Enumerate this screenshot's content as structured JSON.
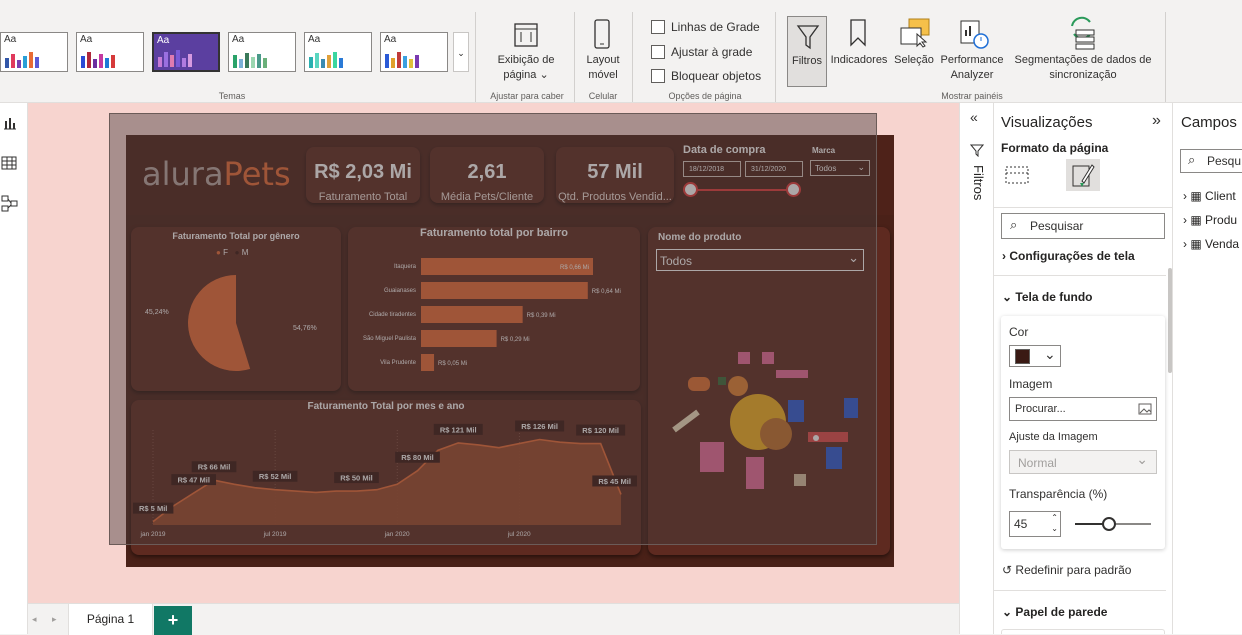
{
  "ribbon": {
    "groups": {
      "themes": "Temas",
      "fit": "Ajustar para caber",
      "mobile": "Celular",
      "page_options": "Opções de página",
      "show_panes": "Mostrar painéis"
    },
    "page_view": {
      "line1": "Exibição de",
      "line2": "página"
    },
    "mobile_layout": {
      "line1": "Layout",
      "line2": "móvel"
    },
    "checkboxes": [
      "Linhas de Grade",
      "Ajustar à grade",
      "Bloquear objetos"
    ],
    "panes": {
      "filters": "Filtros",
      "bookmarks": "Indicadores",
      "selection": "Seleção",
      "performance": {
        "line1": "Performance",
        "line2": "Analyzer"
      },
      "sync": {
        "line1": "Segmentações de dados de",
        "line2": "sincronização"
      }
    },
    "theme_label": "Aa"
  },
  "report": {
    "logo": {
      "part1": "alura",
      "part2": "Pets"
    },
    "kpis": [
      {
        "value": "R$ 2,03 Mi",
        "label": "Faturamento Total"
      },
      {
        "value": "2,61",
        "label": "Média Pets/Cliente"
      },
      {
        "value": "57 Mil",
        "label": "Qtd. Produtos Vendid..."
      }
    ],
    "date_slicer": {
      "title": "Data de compra",
      "from": "18/12/2018",
      "to": "31/12/2020"
    },
    "brand_slicer": {
      "title": "Marca",
      "value": "Todos"
    },
    "gender_chart": {
      "title": "Faturamento Total por gênero",
      "legend": [
        "F",
        "M"
      ],
      "label_left": "45,24%",
      "label_right": "54,76%"
    },
    "bairro_chart": {
      "title": "Faturamento total por bairro"
    },
    "product_slicer": {
      "title": "Nome do produto",
      "value": "Todos"
    },
    "month_chart": {
      "title": "Faturamento Total por mes e ano"
    }
  },
  "chart_data": [
    {
      "type": "pie",
      "title": "Faturamento Total por gênero",
      "categories": [
        "F",
        "M"
      ],
      "values": [
        45.24,
        54.76
      ],
      "colors": [
        "#3a1712",
        "#e86b35"
      ]
    },
    {
      "type": "bar",
      "title": "Faturamento total por bairro",
      "categories": [
        "Itaquera",
        "Guaianases",
        "Cidade tiradentes",
        "São Miguel Paulista",
        "Vila Prudente"
      ],
      "values": [
        0.66,
        0.64,
        0.39,
        0.29,
        0.05
      ],
      "labels": [
        "R$ 0,66 Mi",
        "R$ 0,64 Mi",
        "R$ 0,39 Mi",
        "R$ 0,29 Mi",
        "R$ 0,05 Mi"
      ],
      "unit": "R$ Mi",
      "color": "#e86b35"
    },
    {
      "type": "area",
      "title": "Faturamento Total por mes e ano",
      "x_ticks": [
        "jan 2019",
        "jul 2019",
        "jan 2020",
        "jul 2020"
      ],
      "values": [
        5,
        28,
        47,
        66,
        60,
        55,
        52,
        50,
        48,
        50,
        50,
        52,
        60,
        80,
        110,
        121,
        118,
        114,
        120,
        126,
        122,
        120,
        120,
        45
      ],
      "labeled_points": [
        {
          "index": 0,
          "label": "R$ 5 Mil"
        },
        {
          "index": 2,
          "label": "R$ 47 Mil"
        },
        {
          "index": 3,
          "label": "R$ 66 Mil"
        },
        {
          "index": 6,
          "label": "R$ 52 Mil"
        },
        {
          "index": 10,
          "label": "R$ 50 Mil"
        },
        {
          "index": 13,
          "label": "R$ 80 Mil"
        },
        {
          "index": 15,
          "label": "R$ 121 Mil"
        },
        {
          "index": 19,
          "label": "R$ 126 Mil"
        },
        {
          "index": 22,
          "label": "R$ 120 Mil"
        },
        {
          "index": 23,
          "label": "R$ 45 Mil"
        }
      ],
      "ylim": [
        0,
        140
      ],
      "color": "#e86b35"
    }
  ],
  "tabs": {
    "page1": "Página 1",
    "add": "+"
  },
  "filters_pane": {
    "label": "Filtros"
  },
  "viz_pane": {
    "title": "Visualizações",
    "subtitle": "Formato da página",
    "search_placeholder": "Pesquisar",
    "sections": {
      "canvas_settings": "Configurações de tela",
      "canvas_background": "Tela de fundo",
      "wallpaper": "Papel de parede"
    },
    "color_label": "Cor",
    "color_value": "#3a1a14",
    "image_label": "Imagem",
    "browse": "Procurar...",
    "fit_label": "Ajuste da Imagem",
    "fit_value": "Normal",
    "transparency_label": "Transparência (%)",
    "transparency_value": "45",
    "transparency": 0.45,
    "reset": "Redefinir para padrão"
  },
  "fields_pane": {
    "title": "Campos",
    "search_placeholder": "Pesqu",
    "tables": [
      "Client",
      "Produ",
      "Venda"
    ]
  }
}
